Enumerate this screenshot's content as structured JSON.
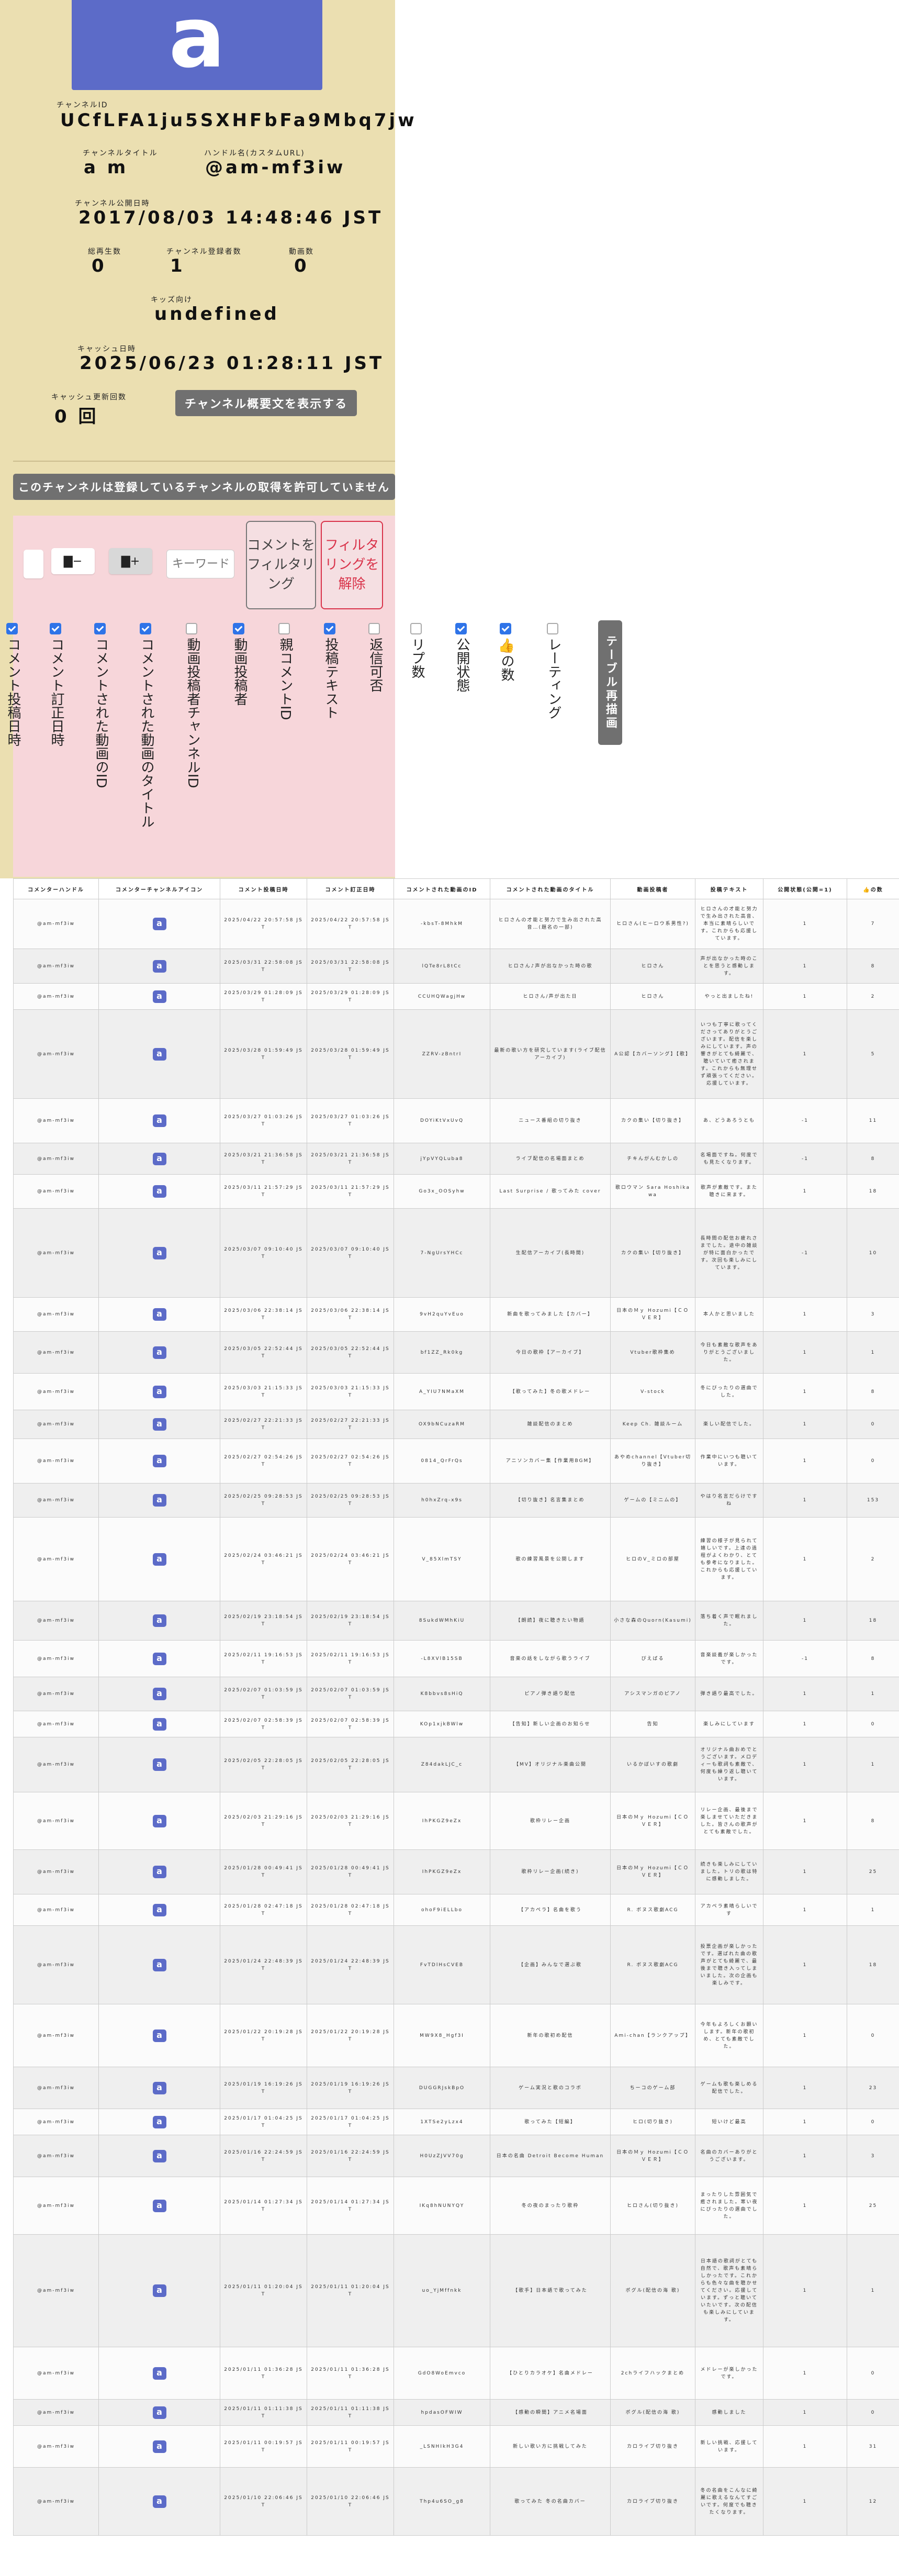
{
  "channel": {
    "avatar_letter": "a",
    "avatar_color": "#5c6bc8",
    "id_label": "チャンネルID",
    "id": "UCfLFA1ju5SXHFbFa9Mbq7jw",
    "title_label": "チャンネルタイトル",
    "title": "a m",
    "handle_label": "ハンドル名(カスタムURL)",
    "handle": "@am-mf3iw",
    "published_label": "チャンネル公開日時",
    "published": "2017/08/03 14:48:46 JST",
    "views_label": "総再生数",
    "views": "0",
    "subs_label": "チャンネル登録者数",
    "subs": "1",
    "videos_label": "動画数",
    "videos": "0",
    "kids_label": "キッズ向け",
    "kids": "undefined",
    "cache_label": "キャッシュ日時",
    "cache": "2025/06/23 01:28:11 JST",
    "cache_count_label": "キャッシュ更新回数",
    "cache_count": "0 回",
    "desc_button": "チャンネル概要文を表示する"
  },
  "notice": "このチャンネルは登録しているチャンネルの取得を許可していません",
  "filters": {
    "minus": "▇−",
    "plus": "▇+",
    "keyword_placeholder": "キーワード",
    "filter_button": "コメントをフィルタリング",
    "clear_button": "フィルタリングを解除",
    "accent": "#d9334a"
  },
  "columns": [
    {
      "label": "コメント投稿日時",
      "checked": true
    },
    {
      "label": "コメント訂正日時",
      "checked": true
    },
    {
      "label": "コメントされた動画のID",
      "checked": true
    },
    {
      "label": "コメントされた動画のタイトル",
      "checked": true
    },
    {
      "label": "動画投稿者チャンネルID",
      "checked": false
    },
    {
      "label": "動画投稿者",
      "checked": true
    },
    {
      "label": "親コメントID",
      "checked": false
    },
    {
      "label": "投稿テキスト",
      "checked": true
    },
    {
      "label": "返信可否",
      "checked": false
    },
    {
      "label": "リプ数",
      "checked": false
    },
    {
      "label": "公開状態",
      "checked": true
    },
    {
      "label": "👍の数",
      "checked": true
    },
    {
      "label": "レーティング",
      "checked": false
    }
  ],
  "redraw_button": "テーブル再描画",
  "table": {
    "headers": [
      "コメンターハンドル",
      "コメンターチャンネルアイコン",
      "コメント投稿日時",
      "コメント訂正日時",
      "コメントされた動画のID",
      "コメントされた動画のタイトル",
      "動画投稿者",
      "投稿テキスト",
      "公開状態(公開=1)",
      "👍の数"
    ],
    "rows": [
      {
        "h": "@am-mf3iw",
        "p": "2025/04/22 20:57:58 JST",
        "e": "2025/04/22 20:57:58 JST",
        "v": "-kbsT-8MhkM",
        "t": "ヒロさんの才能と努力で生み出された高音…(題名の一部)",
        "o": "ヒロさん(ヒーロウ系男性?)",
        "x": "ヒロさんの才能と努力で生み出された高音、本当に素晴らしいです。これからも応援しています。",
        "s": "1",
        "l": "7"
      },
      {
        "h": "@am-mf3iw",
        "p": "2025/03/31 22:58:08 JST",
        "e": "2025/03/31 22:58:08 JST",
        "v": "lQTe8rL8tCc",
        "t": "ヒロさん♪声が出なかった時の歌",
        "o": "ヒロさん",
        "x": "声が出なかった時のことを思うと感動します。",
        "s": "1",
        "l": "8"
      },
      {
        "h": "@am-mf3iw",
        "p": "2025/03/29 01:28:09 JST",
        "e": "2025/03/29 01:28:09 JST",
        "v": "CCUHQWagjHw",
        "t": "ヒロさん/声が出た日",
        "o": "ヒロさん",
        "x": "やっと出ましたね!",
        "s": "1",
        "l": "2"
      },
      {
        "h": "@am-mf3iw",
        "p": "2025/03/28 01:59:49 JST",
        "e": "2025/03/28 01:59:49 JST",
        "v": "ZZRV-zBntrI",
        "t": "最新の歌い方を研究しています(ライブ配信アーカイブ)",
        "o": "A公認【カバーソング】【歌】",
        "x": "いつも丁寧に歌ってくださってありがとうございます。配信を楽しみにしています。声の響きがとても綺麗で、聴いていて癒されます。これからも無理せず頑張ってください。応援しています。",
        "s": "1",
        "l": "5"
      },
      {
        "h": "@am-mf3iw",
        "p": "2025/03/27 01:03:26 JST",
        "e": "2025/03/27 01:03:26 JST",
        "v": "DOYiKtVxUvQ",
        "t": "ニュース番組の切り抜き",
        "o": "カクの集い【切り抜き】",
        "x": "あ、どうあろうとも",
        "s": "-1",
        "l": "11"
      },
      {
        "h": "@am-mf3iw",
        "p": "2025/03/21 21:36:58 JST",
        "e": "2025/03/21 21:36:58 JST",
        "v": "jYpVYQLuba8",
        "t": "ライブ配信の名場面まとめ",
        "o": "チキんがんむかしの",
        "x": "名場面ですね。何度でも見たくなります。",
        "s": "-1",
        "l": "8"
      },
      {
        "h": "@am-mf3iw",
        "p": "2025/03/11 21:57:29 JST",
        "e": "2025/03/11 21:57:29 JST",
        "v": "Go3x_OOSyhw",
        "t": "Last Surprise / 歌ってみた cover",
        "o": "歌ロウマン Sara Hoshikawa",
        "x": "歌声が素敵です。また聴きに来ます。",
        "s": "1",
        "l": "18"
      },
      {
        "h": "@am-mf3iw",
        "p": "2025/03/07 09:10:40 JST",
        "e": "2025/03/07 09:10:40 JST",
        "v": "7-NgUrsYHCc",
        "t": "生配信アーカイブ(長時間)",
        "o": "カクの集い【切り抜き】",
        "x": "長時間の配信お疲れさまでした。途中の雑談が特に面白かったです。次回も楽しみにしています。",
        "s": "-1",
        "l": "10"
      },
      {
        "h": "@am-mf3iw",
        "p": "2025/03/06 22:38:14 JST",
        "e": "2025/03/06 22:38:14 JST",
        "v": "9vH2quYvEuo",
        "t": "新曲を歌ってみました【カバー】",
        "o": "日本のＭｙ Hozumi【ＣＯＶＥＲ】",
        "x": "本人かと思いました",
        "s": "1",
        "l": "3"
      },
      {
        "h": "@am-mf3iw",
        "p": "2025/03/05 22:52:44 JST",
        "e": "2025/03/05 22:52:44 JST",
        "v": "bf1ZZ_Rk0kg",
        "t": "今日の歌枠【アーカイブ】",
        "o": "Vtuber歌枠集め",
        "x": "今日も素敵な歌声をありがとうございました。",
        "s": "1",
        "l": "1"
      },
      {
        "h": "@am-mf3iw",
        "p": "2025/03/03 21:15:33 JST",
        "e": "2025/03/03 21:15:33 JST",
        "v": "A_YIU7NMaXM",
        "t": "【歌ってみた】冬の歌メドレー",
        "o": "V-stock",
        "x": "冬にぴったりの選曲でした。",
        "s": "1",
        "l": "8"
      },
      {
        "h": "@am-mf3iw",
        "p": "2025/02/27 22:21:33 JST",
        "e": "2025/02/27 22:21:33 JST",
        "v": "OX9bNCuzaRM",
        "t": "雑談配信のまとめ",
        "o": "Keep Ch. 雑談ルーム",
        "x": "楽しい配信でした。",
        "s": "1",
        "l": "0"
      },
      {
        "h": "@am-mf3iw",
        "p": "2025/02/27 02:54:26 JST",
        "e": "2025/02/27 02:54:26 JST",
        "v": "0814_QrFrQs",
        "t": "アニソンカバー集【作業用BGM】",
        "o": "あやめchannel【Vtuber切り抜き】",
        "x": "作業中にいつも聴いています。",
        "s": "1",
        "l": "0"
      },
      {
        "h": "@am-mf3iw",
        "p": "2025/02/25 09:28:53 JST",
        "e": "2025/02/25 09:28:53 JST",
        "v": "h0hxZrq-x9s",
        "t": "【切り抜き】名言集まとめ",
        "o": "ゲームの【ミニムの】",
        "x": "やはり名言だらけですね",
        "s": "1",
        "l": "153"
      },
      {
        "h": "@am-mf3iw",
        "p": "2025/02/24 03:46:21 JST",
        "e": "2025/02/24 03:46:21 JST",
        "v": "V_85XlmTSY",
        "t": "歌の練習風景を公開します",
        "o": "ヒロのV_ミロの部屋",
        "x": "練習の様子が見られて嬉しいです。上達の過程がよくわかり、とても参考になりました。これからも応援しています。",
        "s": "1",
        "l": "2"
      },
      {
        "h": "@am-mf3iw",
        "p": "2025/02/19 23:18:54 JST",
        "e": "2025/02/19 23:18:54 JST",
        "v": "8SukdWMhKiU",
        "t": "【朗読】夜に聴きたい物語",
        "o": "小さな森のQuorn(Kasumi)",
        "x": "落ち着く声で眠れました。",
        "s": "1",
        "l": "18"
      },
      {
        "h": "@am-mf3iw",
        "p": "2025/02/11 19:16:53 JST",
        "e": "2025/02/11 19:16:53 JST",
        "v": "-L8XVlB15SB",
        "t": "音楽の話をしながら歌うライブ",
        "o": "ぴえばる",
        "x": "音楽談義が楽しかったです。",
        "s": "-1",
        "l": "8"
      },
      {
        "h": "@am-mf3iw",
        "p": "2025/02/07 01:03:59 JST",
        "e": "2025/02/07 01:03:59 JST",
        "v": "K8bbvs8sHiQ",
        "t": "ピアノ弾き語り配信",
        "o": "アシスマンガのピアノ",
        "x": "弾き語り最高でした。",
        "s": "1",
        "l": "1"
      },
      {
        "h": "@am-mf3iw",
        "p": "2025/02/07 02:58:39 JST",
        "e": "2025/02/07 02:58:39 JST",
        "v": "KOp1xjkBWlw",
        "t": "【告知】新しい企画のお知らせ",
        "o": "告知",
        "x": "楽しみにしています",
        "s": "1",
        "l": "0"
      },
      {
        "h": "@am-mf3iw",
        "p": "2025/02/05 22:28:05 JST",
        "e": "2025/02/05 22:28:05 JST",
        "v": "Z84dakLJC_c",
        "t": "【MV】オリジナル楽曲公開",
        "o": "いるかぼいすの歌劇",
        "x": "オリジナル曲おめでとうございます。メロディーも歌詞も素敵で、何度も繰り返し聴いています。",
        "s": "1",
        "l": "1"
      },
      {
        "h": "@am-mf3iw",
        "p": "2025/02/03 21:29:16 JST",
        "e": "2025/02/03 21:29:16 JST",
        "v": "IhPKGZ9eZx",
        "t": "歌枠リレー企画",
        "o": "日本のＭｙ Hozumi【ＣＯＶＥＲ】",
        "x": "リレー企画、最後まで楽しませていただきました。皆さんの歌声がとても素敵でした。",
        "s": "1",
        "l": "8"
      },
      {
        "h": "@am-mf3iw",
        "p": "2025/01/28 00:49:41 JST",
        "e": "2025/01/28 00:49:41 JST",
        "v": "IhPKGZ9eZx",
        "t": "歌枠リレー企画(続き)",
        "o": "日本のＭｙ Hozumi【ＣＯＶＥＲ】",
        "x": "続きも楽しみにしていました。トリの歌は特に感動しました。",
        "s": "1",
        "l": "25"
      },
      {
        "h": "@am-mf3iw",
        "p": "2025/01/28 02:47:18 JST",
        "e": "2025/01/28 02:47:18 JST",
        "v": "ohoF9iELLbo",
        "t": "【アカペラ】名曲を歌う",
        "o": "R. ボヌス歌劇ACG",
        "x": "アカペラ素晴らしいです",
        "s": "1",
        "l": "1"
      },
      {
        "h": "@am-mf3iw",
        "p": "2025/01/24 22:48:39 JST",
        "e": "2025/01/24 22:48:39 JST",
        "v": "FvTDlHsCVEB",
        "t": "【企画】みんなで選ぶ歌",
        "o": "R. ボヌス歌劇ACG",
        "x": "投票企画が楽しかったです。選ばれた曲の歌声がとても綺麗で、最後まで聴き入ってしまいました。次の企画も楽しみです。",
        "s": "1",
        "l": "18"
      },
      {
        "h": "@am-mf3iw",
        "p": "2025/01/22 20:19:28 JST",
        "e": "2025/01/22 20:19:28 JST",
        "v": "MW9X8_Hgf3I",
        "t": "新年の歌初め配信",
        "o": "Ami-chan【ランクアップ】",
        "x": "今年もよろしくお願いします。新年の歌初め、とても素敵でした。",
        "s": "1",
        "l": "0"
      },
      {
        "h": "@am-mf3iw",
        "p": "2025/01/19 16:19:26 JST",
        "e": "2025/01/19 16:19:26 JST",
        "v": "DUGGRJskBpO",
        "t": "ゲーム実況と歌のコラボ",
        "o": "ちーコのゲーム部",
        "x": "ゲームも歌も楽しめる配信でした。",
        "s": "1",
        "l": "23"
      },
      {
        "h": "@am-mf3iw",
        "p": "2025/01/17 01:04:25 JST",
        "e": "2025/01/17 01:04:25 JST",
        "v": "1XTSe2yLzx4",
        "t": "歌ってみた【短編】",
        "o": "ヒロ(切り抜き)",
        "x": "短いけど最高",
        "s": "1",
        "l": "0"
      },
      {
        "h": "@am-mf3iw",
        "p": "2025/01/16 22:24:59 JST",
        "e": "2025/01/16 22:24:59 JST",
        "v": "H0UzZJVV70g",
        "t": "日本の名曲 Detroit Become Human",
        "o": "日本のＭｙ Hozumi【ＣＯＶＥＲ】",
        "x": "名曲のカバーありがとうございます。",
        "s": "1",
        "l": "3"
      },
      {
        "h": "@am-mf3iw",
        "p": "2025/01/14 01:27:34 JST",
        "e": "2025/01/14 01:27:34 JST",
        "v": "IKq8hNUNYQY",
        "t": "冬の夜のまったり歌枠",
        "o": "ヒロさん(切り抜き)",
        "x": "まったりした雰囲気で癒されました。寒い夜にぴったりの選曲でした。",
        "s": "1",
        "l": "25"
      },
      {
        "h": "@am-mf3iw",
        "p": "2025/01/11 01:20:04 JST",
        "e": "2025/01/11 01:20:04 JST",
        "v": "uo_YjMffnkk",
        "t": "【歌手】日本語で歌ってみた",
        "o": "ポグル(配信の海 歌)",
        "x": "日本語の歌詞がとても自然で、歌声も素晴らしかったです。これからも色々な曲を聴かせてください。応援しています。ずっと聴いていたいです。次の配信も楽しみにしています。",
        "s": "1",
        "l": "1"
      },
      {
        "h": "@am-mf3iw",
        "p": "2025/01/11 01:36:28 JST",
        "e": "2025/01/11 01:36:28 JST",
        "v": "GdO8WoEmvco",
        "t": "【ひとりカラオケ】名曲メドレー",
        "o": "2chライフハックまとめ",
        "x": "メドレーが楽しかったです。",
        "s": "1",
        "l": "0"
      },
      {
        "h": "@am-mf3iw",
        "p": "2025/01/11 01:11:38 JST",
        "e": "2025/01/11 01:11:38 JST",
        "v": "hpdasOFWIW",
        "t": "【感動の瞬間】アニメ名場面",
        "o": "ポグル(配信の海 歌)",
        "x": "感動しました",
        "s": "1",
        "l": "0"
      },
      {
        "h": "@am-mf3iw",
        "p": "2025/01/11 00:19:57 JST",
        "e": "2025/01/11 00:19:57 JST",
        "v": "_LSNHIkH3G4",
        "t": "新しい歌い方に挑戦してみた",
        "o": "カロライブ切り抜き",
        "x": "新しい挑戦、応援しています。",
        "s": "1",
        "l": "31"
      },
      {
        "h": "@am-mf3iw",
        "p": "2025/01/10 22:06:46 JST",
        "e": "2025/01/10 22:06:46 JST",
        "v": "Thp4u6SO_g8",
        "t": "歌ってみた 冬の名曲カバー",
        "o": "カロライブ切り抜き",
        "x": "冬の名曲をこんなに綺麗に歌えるなんてすごいです。何度でも聴きたくなります。",
        "s": "1",
        "l": "12"
      }
    ]
  }
}
